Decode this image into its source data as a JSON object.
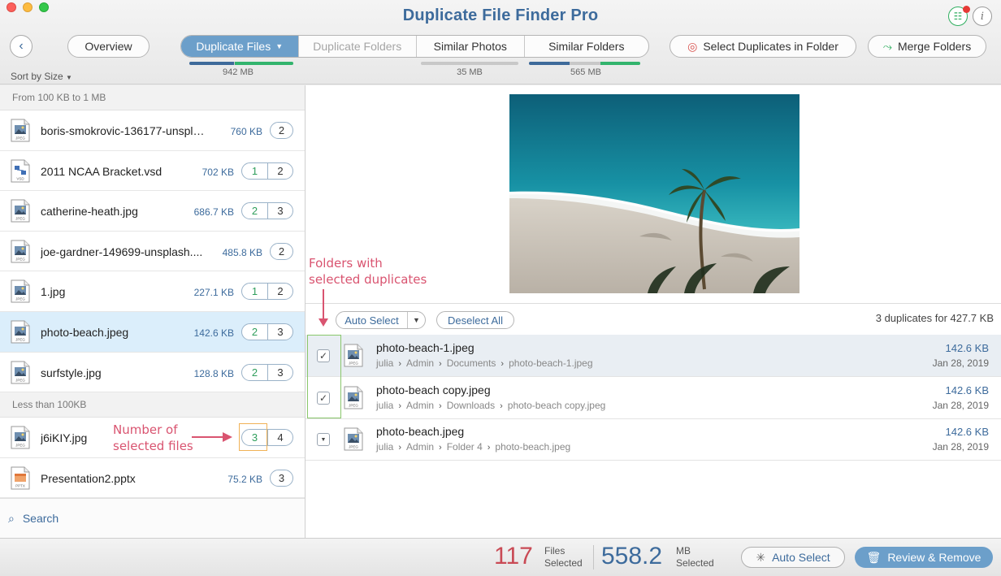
{
  "app": {
    "title": "Duplicate File Finder Pro"
  },
  "toolbar": {
    "overview_label": "Overview",
    "tabs": [
      {
        "label": "Duplicate Files",
        "size": "942 MB",
        "state": "active",
        "has_dropdown": true,
        "progress": 0.56
      },
      {
        "label": "Duplicate Folders",
        "size": "",
        "state": "disabled"
      },
      {
        "label": "Similar Photos",
        "size": "35 MB",
        "state": "normal",
        "progress": 0
      },
      {
        "label": "Similar Folders",
        "size": "565 MB",
        "state": "normal",
        "progress": 0.36
      }
    ],
    "select_duplicates_label": "Select Duplicates in Folder",
    "merge_folders_label": "Merge Folders",
    "sort_label": "Sort by Size"
  },
  "file_groups": [
    {
      "header": "From 100 KB to 1 MB",
      "files": [
        {
          "name": "boris-smokrovic-136177-unspla...",
          "size": "760 KB",
          "badges": [
            "2"
          ],
          "selected_badge": null,
          "icon": "jpeg-file-icon",
          "type": "JPEG"
        },
        {
          "name": "2011 NCAA Bracket.vsd",
          "size": "702 KB",
          "badges": [
            "1",
            "2"
          ],
          "selected_badge": 0,
          "icon": "vsd-file-icon",
          "type": "VSD"
        },
        {
          "name": "catherine-heath.jpg",
          "size": "686.7 KB",
          "badges": [
            "2",
            "3"
          ],
          "selected_badge": 0,
          "icon": "jpeg-file-icon",
          "type": "JPEG"
        },
        {
          "name": "joe-gardner-149699-unsplash....",
          "size": "485.8 KB",
          "badges": [
            "2"
          ],
          "selected_badge": null,
          "icon": "jpeg-file-icon",
          "type": "JPEG"
        },
        {
          "name": "1.jpg",
          "size": "227.1 KB",
          "badges": [
            "1",
            "2"
          ],
          "selected_badge": 0,
          "icon": "jpeg-file-icon",
          "type": "JPEG"
        },
        {
          "name": "photo-beach.jpeg",
          "size": "142.6 KB",
          "badges": [
            "2",
            "3"
          ],
          "selected_badge": 0,
          "icon": "jpeg-file-icon",
          "type": "JPEG",
          "row_selected": true
        },
        {
          "name": "surfstyle.jpg",
          "size": "128.8 KB",
          "badges": [
            "2",
            "3"
          ],
          "selected_badge": 0,
          "icon": "jpeg-file-icon",
          "type": "JPEG"
        }
      ]
    },
    {
      "header": "Less than 100KB",
      "files": [
        {
          "name": "j6iKIY.jpg",
          "size": "",
          "badges": [
            "3",
            "4"
          ],
          "selected_badge": 0,
          "icon": "jpeg-file-icon",
          "type": "JPEG"
        },
        {
          "name": "Presentation2.pptx",
          "size": "75.2 KB",
          "badges": [
            "3"
          ],
          "selected_badge": null,
          "icon": "pptx-file-icon",
          "type": "PPTX"
        }
      ]
    }
  ],
  "search": {
    "label": "Search"
  },
  "annotations": {
    "folders_line1": "Folders with",
    "folders_line2": "selected duplicates",
    "files_line1": "Number of",
    "files_line2": "selected files"
  },
  "duplicates": {
    "auto_select_label": "Auto Select",
    "deselect_all_label": "Deselect All",
    "summary": "3 duplicates for 427.7 KB",
    "items": [
      {
        "name": "photo-beach-1.jpeg",
        "path": [
          "julia",
          "Admin",
          "Documents",
          "photo-beach-1.jpeg"
        ],
        "size": "142.6 KB",
        "date": "Jan 28, 2019",
        "checked": true,
        "icon_type": "JPEG"
      },
      {
        "name": "photo-beach copy.jpeg",
        "path": [
          "julia",
          "Admin",
          "Downloads",
          "photo-beach copy.jpeg"
        ],
        "size": "142.6 KB",
        "date": "Jan 28, 2019",
        "checked": true,
        "icon_type": "JPEG"
      },
      {
        "name": "photo-beach.jpeg",
        "path": [
          "julia",
          "Admin",
          "Folder 4",
          "photo-beach.jpeg"
        ],
        "size": "142.6 KB",
        "date": "Jan 28, 2019",
        "checked": false,
        "icon_type": "JPEG"
      }
    ]
  },
  "bottom": {
    "files_count": "117",
    "files_label_1": "Files",
    "files_label_2": "Selected",
    "mb_count": "558.2",
    "mb_label_1": "MB",
    "mb_label_2": "Selected",
    "auto_select_label": "Auto Select",
    "review_label": "Review & Remove"
  },
  "colors": {
    "accent": "#6c9fca",
    "brand_blue": "#3d6b9c",
    "red_count": "#c94a55",
    "green": "#33b46d",
    "annotation": "#d95470"
  }
}
